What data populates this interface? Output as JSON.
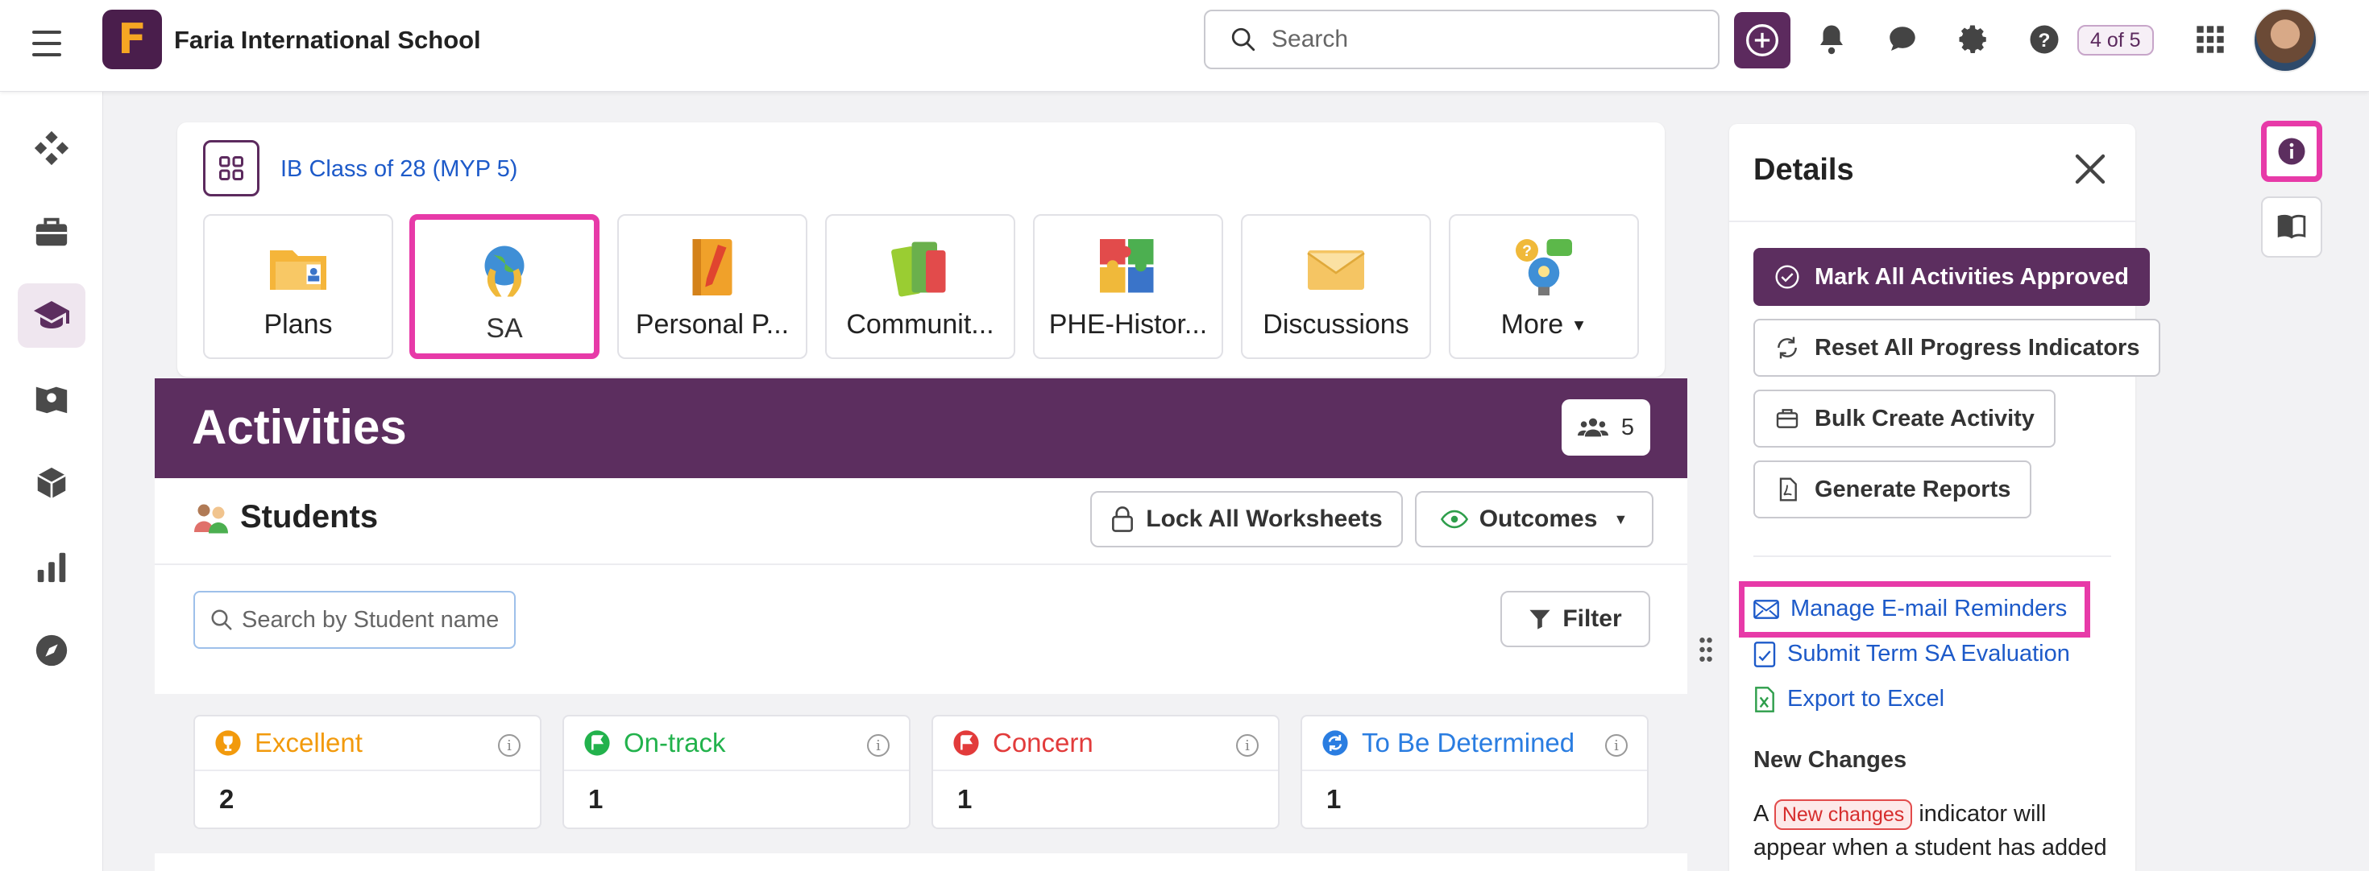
{
  "header": {
    "school_name": "Faria International School",
    "logo_letter": "F",
    "search_placeholder": "Search",
    "counter": "4 of 5"
  },
  "sidebar": {
    "items": [
      {
        "icon": "dashboard-diamond-icon"
      },
      {
        "icon": "briefcase-icon"
      },
      {
        "icon": "graduation-cap-icon",
        "active": true
      },
      {
        "icon": "map-book-icon"
      },
      {
        "icon": "cube-icon"
      },
      {
        "icon": "bar-chart-icon"
      },
      {
        "icon": "compass-icon"
      }
    ]
  },
  "class_card": {
    "class_name": "IB Class of 28 (MYP 5)",
    "tiles": [
      {
        "label": "Plans",
        "icon": "plans-folder-icon"
      },
      {
        "label": "SA",
        "icon": "globe-hands-icon",
        "highlighted": true
      },
      {
        "label": "Personal P...",
        "icon": "notebook-icon"
      },
      {
        "label": "Communit...",
        "icon": "books-icon"
      },
      {
        "label": "PHE-Histor...",
        "icon": "puzzle-icon"
      },
      {
        "label": "Discussions",
        "icon": "envelope-icon"
      },
      {
        "label": "More",
        "icon": "lightbulb-chat-icon"
      }
    ]
  },
  "activities": {
    "title": "Activities",
    "people_count": "5",
    "students_heading": "Students",
    "lock_label": "Lock All Worksheets",
    "outcomes_label": "Outcomes",
    "search_placeholder": "Search by Student name",
    "filter_label": "Filter"
  },
  "stats": [
    {
      "label": "Excellent",
      "value": "2",
      "color": "#f29a0c"
    },
    {
      "label": "On-track",
      "value": "1",
      "color": "#22b24c"
    },
    {
      "label": "Concern",
      "value": "1",
      "color": "#e23b3b"
    },
    {
      "label": "To Be Determined",
      "value": "1",
      "color": "#2a7de1"
    }
  ],
  "details": {
    "title": "Details",
    "buttons": {
      "approve": "Mark All Activities Approved",
      "reset": "Reset All Progress Indicators",
      "bulk": "Bulk Create Activity",
      "reports": "Generate Reports"
    },
    "links": {
      "reminders": "Manage E-mail Reminders",
      "submit": "Submit Term SA Evaluation",
      "export": "Export to Excel"
    },
    "new_changes_title": "New Changes",
    "nc_prefix": "A",
    "nc_pill": "New changes",
    "nc_suffix": "indicator will appear when a student has added an activity or uploaded"
  },
  "colors": {
    "brand": "#5c2e5f",
    "highlight": "#e73aa8",
    "link": "#1d5ac9"
  }
}
